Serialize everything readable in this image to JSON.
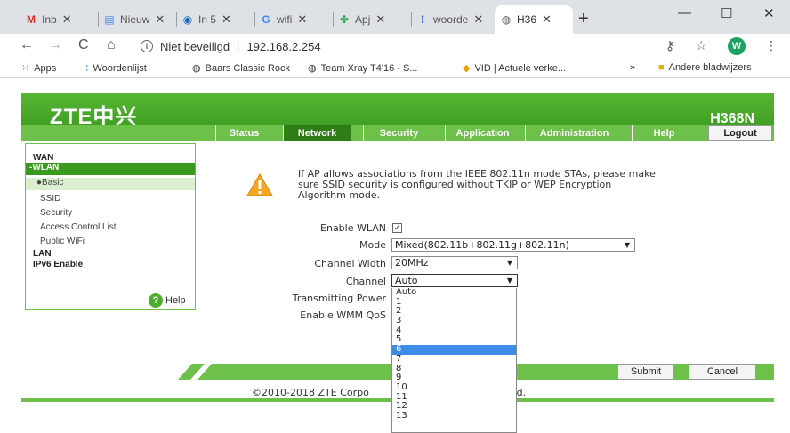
{
  "browser": {
    "tabs": [
      {
        "icon": "gmail-icon",
        "title": "Inb",
        "active": false
      },
      {
        "icon": "doc-icon",
        "title": "Nieuw",
        "active": false
      },
      {
        "icon": "circle-icon",
        "title": "In 5",
        "active": false
      },
      {
        "icon": "google-icon",
        "title": "wifi",
        "active": false
      },
      {
        "icon": "app-icon",
        "title": "Apj",
        "active": false
      },
      {
        "icon": "dict-icon",
        "title": "woorde",
        "active": false
      },
      {
        "icon": "globe-icon",
        "title": "H36",
        "active": true
      }
    ],
    "address": {
      "security_text": "Niet beveiligd",
      "url": "192.168.2.254"
    },
    "avatar_initial": "W",
    "bookmarks": [
      {
        "label": "Apps"
      },
      {
        "label": "Woordenlijst"
      },
      {
        "label": "Baars Classic Rock"
      },
      {
        "label": "Team Xray T4'16 - S..."
      },
      {
        "label": "VID | Actuele verke..."
      }
    ],
    "bookmarks_overflow": "»",
    "other_bookmarks": "Andere bladwijzers"
  },
  "router": {
    "logo": "ZTE中兴",
    "model": "H368N",
    "nav": [
      "Status",
      "Network",
      "Security",
      "Application",
      "Administration",
      "Help"
    ],
    "nav_active": "Network",
    "logout_label": "Logout",
    "sidebar": {
      "wan": "WAN",
      "wlan": "-WLAN",
      "basic": "Basic",
      "ssid": "SSID",
      "security": "Security",
      "acl": "Access Control List",
      "public_wifi": "Public WiFi",
      "lan": "LAN",
      "ipv6": "IPv6 Enable",
      "help": "Help"
    },
    "notice_line1": "If AP allows associations from the IEEE 802.11n mode STAs, please make",
    "notice_line2": "sure SSID security is configured without TKIP or WEP Encryption",
    "notice_line3": "Algorithm mode.",
    "form": {
      "enable_wlan_label": "Enable WLAN",
      "enable_wlan_checked": true,
      "mode_label": "Mode",
      "mode_value": "Mixed(802.11b+802.11g+802.11n)",
      "channel_width_label": "Channel Width",
      "channel_width_value": "20MHz",
      "channel_label": "Channel",
      "channel_value": "Auto",
      "tx_power_label": "Transmitting Power",
      "wmm_label": "Enable WMM QoS"
    },
    "channel_options": [
      "Auto",
      "1",
      "2",
      "3",
      "4",
      "5",
      "6",
      "7",
      "8",
      "9",
      "10",
      "11",
      "12",
      "13"
    ],
    "channel_highlighted": "6",
    "submit_label": "Submit",
    "cancel_label": "Cancel",
    "copyright_left": "©2010-2018 ZTE Corpo",
    "copyright_right": "rved."
  },
  "colors": {
    "zte_green": "#3a9a1e",
    "nav_green": "#6dc04a",
    "highlight": "#3e8ce6"
  }
}
